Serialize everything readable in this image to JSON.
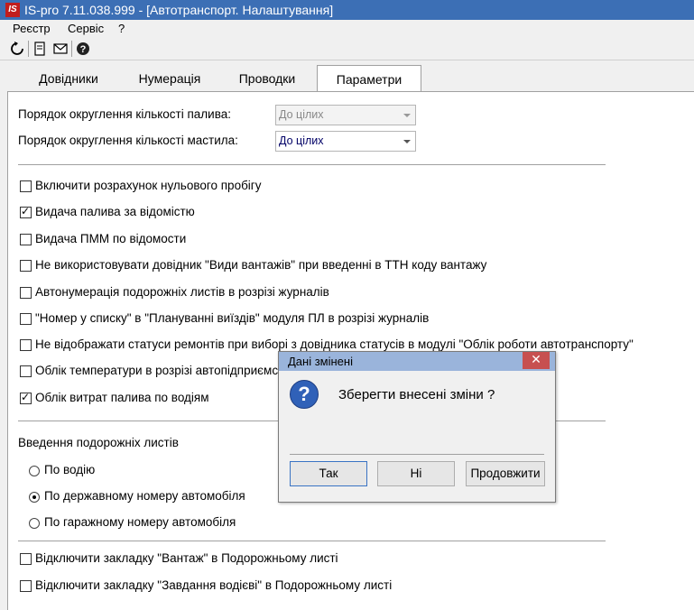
{
  "window": {
    "title": "IS-pro 7.11.038.999 - [Автотранспорт. Налаштування]",
    "logo_text": "IS"
  },
  "menu": {
    "items": [
      "Реєстр",
      "Сервіс",
      "?"
    ]
  },
  "toolbar": {
    "icons": [
      "refresh-icon",
      "document-icon",
      "mail-icon",
      "help-icon"
    ]
  },
  "tabs": [
    {
      "label": "Довідники",
      "active": false
    },
    {
      "label": "Нумерація",
      "active": false
    },
    {
      "label": "Проводки",
      "active": false
    },
    {
      "label": "Параметри",
      "active": true
    }
  ],
  "params": {
    "fuel_rounding_label": "Порядок округлення кількості палива:",
    "fuel_rounding_value": "До цілих",
    "oil_rounding_label": "Порядок округлення кількості мастила:",
    "oil_rounding_value": "До цілих"
  },
  "checkboxes": [
    {
      "label": "Включити розрахунок нульового пробігу",
      "checked": false
    },
    {
      "label": "Видача палива за відомістю",
      "checked": true
    },
    {
      "label": "Видача ПММ по відомости",
      "checked": false
    },
    {
      "label": "Не використовувати довідник \"Види вантажів\" при введенні в ТТН коду вантажу",
      "checked": false
    },
    {
      "label": "Автонумерація подорожніх листів в розрізі журналів",
      "checked": false
    },
    {
      "label": "\"Номер у списку\" в \"Плануванні виїздів\" модуля ПЛ в розрізі журналів",
      "checked": false
    },
    {
      "label": "Не відображати статуси ремонтів при виборі з довідника статусів в модулі \"Облік роботи автотранспорту\"",
      "checked": false
    },
    {
      "label": "Облік температури в розрізі автопідприємств",
      "checked": false
    },
    {
      "label": "Облік витрат палива по водіям",
      "checked": true
    }
  ],
  "waybill_entry": {
    "label": "Введення подорожніх листів",
    "options": [
      {
        "label": "По водію",
        "selected": false
      },
      {
        "label": "По державному номеру автомобіля",
        "selected": true
      },
      {
        "label": "По гаражному номеру автомобіля",
        "selected": false
      }
    ]
  },
  "bottom_checkboxes": [
    {
      "label": "Відключити закладку \"Вантаж\" в Подорожньому листі",
      "checked": false
    },
    {
      "label": "Відключити закладку \"Завдання водієві\" в Подорожньому листі",
      "checked": false
    }
  ],
  "dialog": {
    "title": "Дані змінені",
    "close_glyph": "✕",
    "icon_glyph": "?",
    "message": "Зберегти внесені зміни ?",
    "buttons": {
      "yes": "Так",
      "no": "Ні",
      "continue": "Продовжити"
    }
  },
  "colors": {
    "titlebar": "#3c6fb5",
    "dialog_titlebar": "#9ab4db",
    "close_button": "#c75050",
    "question_icon": "#3061b8"
  }
}
